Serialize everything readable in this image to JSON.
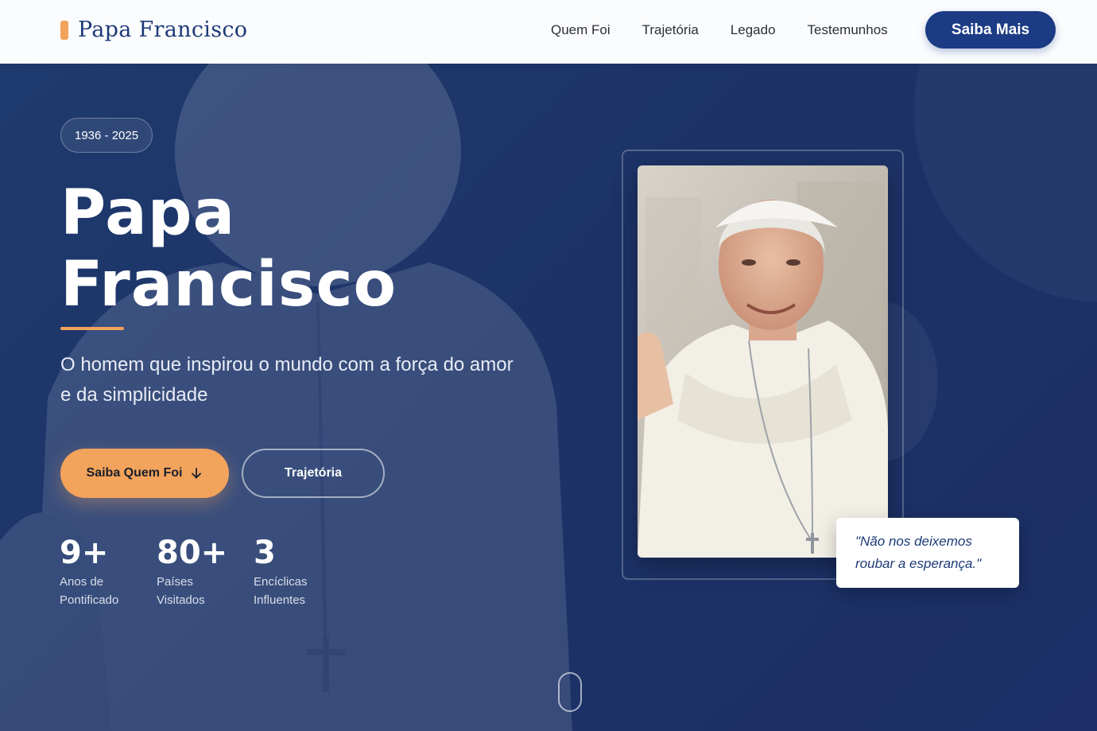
{
  "nav": {
    "logo": "Papa Francisco",
    "links": [
      "Quem Foi",
      "Trajetória",
      "Legado",
      "Testemunhos"
    ],
    "cta": "Saiba Mais"
  },
  "hero": {
    "badge": "1936 - 2025",
    "title_line1": "Papa",
    "title_line2": "Francisco",
    "subtitle": "O homem que inspirou o mundo com a força do amor e da simplicidade",
    "primary_button": "Saiba Quem Foi",
    "secondary_button": "Trajetória",
    "stats": [
      {
        "number": "9+",
        "label": "Anos de Pontificado"
      },
      {
        "number": "80+",
        "label": "Países Visitados"
      },
      {
        "number": "3",
        "label": "Encíclicas Influentes"
      }
    ],
    "quote": "\"Não nos deixemos roubar a esperança.\""
  },
  "colors": {
    "accent": "#f2a35c",
    "brand": "#1b3b85",
    "hero_bg": "#1d3367"
  }
}
